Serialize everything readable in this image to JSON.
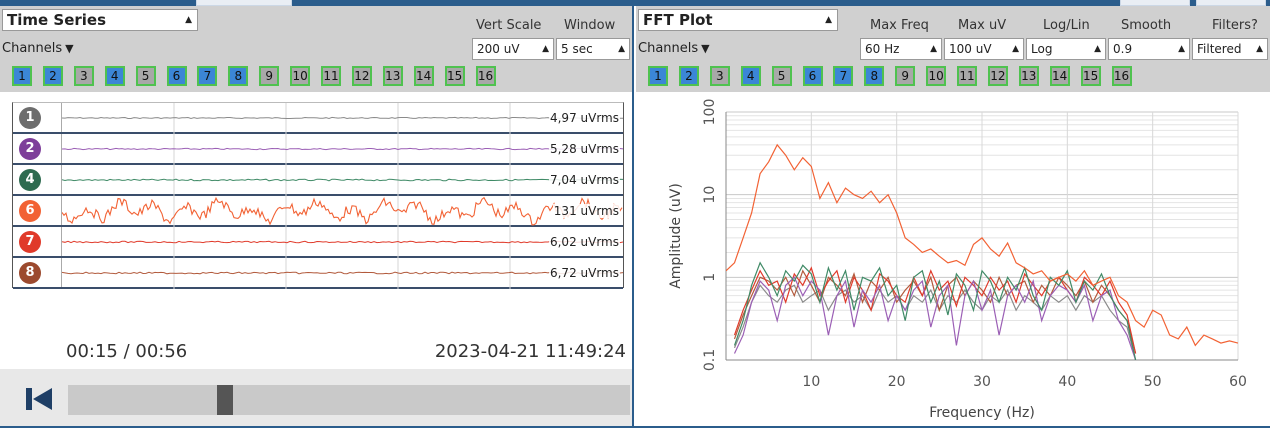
{
  "time_series": {
    "title": "Time Series",
    "vert_scale_label": "Vert Scale",
    "window_label": "Window",
    "vert_scale_value": "200 uV",
    "window_value": "5 sec",
    "channels_label": "Channels",
    "channel_buttons": [
      "1",
      "2",
      "3",
      "4",
      "5",
      "6",
      "7",
      "8",
      "9",
      "10",
      "11",
      "12",
      "13",
      "14",
      "15",
      "16"
    ],
    "channel_active": [
      true,
      true,
      false,
      true,
      false,
      true,
      true,
      true,
      false,
      false,
      false,
      false,
      false,
      false,
      false,
      false
    ],
    "rows": [
      {
        "channel": "1",
        "color": "#6d6d6d",
        "trace_color": "#8a8a8a",
        "rms": "4,97 uVrms",
        "amp": 0.7
      },
      {
        "channel": "2",
        "color": "#7e3f9a",
        "trace_color": "#9b5fb5",
        "rms": "5,28 uVrms",
        "amp": 0.8
      },
      {
        "channel": "4",
        "color": "#2e6b50",
        "trace_color": "#3f8a66",
        "rms": "7,04 uVrms",
        "amp": 1.0
      },
      {
        "channel": "6",
        "color": "#f26234",
        "trace_color": "#f26234",
        "rms": "131 uVrms",
        "amp": 12
      },
      {
        "channel": "7",
        "color": "#e03a2a",
        "trace_color": "#e03a2a",
        "rms": "6,02 uVrms",
        "amp": 0.9
      },
      {
        "channel": "8",
        "color": "#9c4a2e",
        "trace_color": "#b25a3c",
        "rms": "6,72 uVrms",
        "amp": 1.0
      }
    ],
    "time_display": "00:15 / 00:56",
    "timestamp": "2023-04-21 11:49:24",
    "playback_fraction": 0.28
  },
  "fft": {
    "title": "FFT Plot",
    "controls": [
      {
        "label": "Max Freq",
        "value": "60 Hz"
      },
      {
        "label": "Max uV",
        "value": "100 uV"
      },
      {
        "label": "Log/Lin",
        "value": "Log"
      },
      {
        "label": "Smooth",
        "value": "0.9"
      },
      {
        "label": "Filters?",
        "value": "Filtered"
      }
    ],
    "channels_label": "Channels",
    "channel_buttons": [
      "1",
      "2",
      "3",
      "4",
      "5",
      "6",
      "7",
      "8",
      "9",
      "10",
      "11",
      "12",
      "13",
      "14",
      "15",
      "16"
    ],
    "channel_active": [
      true,
      true,
      false,
      true,
      false,
      true,
      true,
      true,
      false,
      false,
      false,
      false,
      false,
      false,
      false,
      false
    ]
  },
  "chart_data": {
    "type": "line",
    "title": "",
    "xlabel": "Frequency (Hz)",
    "ylabel": "Amplitude (uV)",
    "xlim": [
      0,
      60
    ],
    "ylim": [
      0.1,
      100
    ],
    "yscale": "log",
    "grid": true,
    "x_ticks": [
      "10",
      "20",
      "30",
      "40",
      "50",
      "60"
    ],
    "y_ticks": [
      "0.1",
      "1",
      "10",
      "100"
    ],
    "series": [
      {
        "color": "#f26234",
        "x": [
          0,
          1,
          2,
          3,
          4,
          5,
          6,
          7,
          8,
          9,
          10,
          11,
          12,
          13,
          14,
          15,
          16,
          17,
          18,
          19,
          20,
          21,
          22,
          23,
          24,
          25,
          26,
          27,
          28,
          29,
          30,
          31,
          32,
          33,
          34,
          35,
          36,
          37,
          38,
          39,
          40,
          41,
          42,
          43,
          44,
          45,
          46,
          47,
          48,
          49,
          50,
          51,
          52,
          53,
          54,
          55,
          56,
          57,
          58,
          59,
          60
        ],
        "y": [
          1.2,
          1.5,
          3,
          6,
          18,
          25,
          40,
          30,
          20,
          28,
          22,
          9,
          14,
          8,
          12,
          10,
          9,
          11,
          8,
          10,
          6,
          3,
          2.5,
          2,
          2.2,
          1.8,
          1.5,
          1.6,
          1.4,
          2.5,
          3,
          2.2,
          1.8,
          2.6,
          1.5,
          1.3,
          1.1,
          1.2,
          0.9,
          1.0,
          1.1,
          0.9,
          1.2,
          0.8,
          0.9,
          1.0,
          0.6,
          0.5,
          0.3,
          0.25,
          0.4,
          0.35,
          0.2,
          0.18,
          0.25,
          0.15,
          0.2,
          0.18,
          0.16,
          0.17,
          0.16
        ]
      },
      {
        "color": "#3f8a66",
        "x": [
          1,
          2,
          3,
          4,
          5,
          6,
          7,
          8,
          9,
          10,
          11,
          12,
          13,
          14,
          15,
          16,
          17,
          18,
          19,
          20,
          21,
          22,
          23,
          24,
          25,
          26,
          27,
          28,
          29,
          30,
          31,
          32,
          33,
          34,
          35,
          36,
          37,
          38,
          39,
          40,
          41,
          42,
          43,
          44,
          45,
          46,
          47,
          48
        ],
        "y": [
          0.15,
          0.3,
          0.8,
          1.5,
          1.0,
          0.6,
          1.2,
          0.9,
          1.4,
          1.1,
          0.5,
          1.3,
          0.7,
          1.2,
          0.4,
          1.0,
          0.9,
          1.3,
          0.6,
          0.8,
          0.3,
          1.0,
          1.2,
          0.5,
          0.9,
          0.35,
          1.1,
          0.8,
          0.4,
          1.2,
          0.9,
          0.5,
          1.0,
          0.7,
          1.3,
          0.6,
          0.4,
          1.0,
          0.8,
          1.2,
          0.5,
          0.9,
          0.7,
          1.1,
          0.6,
          0.4,
          0.3,
          0.1
        ]
      },
      {
        "color": "#9b5fb5",
        "x": [
          1,
          2,
          3,
          4,
          5,
          6,
          7,
          8,
          9,
          10,
          11,
          12,
          13,
          14,
          15,
          16,
          17,
          18,
          19,
          20,
          21,
          22,
          23,
          24,
          25,
          26,
          27,
          28,
          29,
          30,
          31,
          32,
          33,
          34,
          35,
          36,
          37,
          38,
          39,
          40,
          41,
          42,
          43,
          44,
          45,
          46,
          47,
          48
        ],
        "y": [
          0.12,
          0.2,
          0.5,
          0.9,
          0.7,
          0.3,
          0.8,
          1.0,
          0.6,
          0.9,
          0.7,
          0.2,
          0.6,
          0.9,
          0.25,
          0.7,
          0.5,
          0.8,
          0.3,
          0.6,
          0.4,
          0.7,
          0.9,
          0.25,
          0.6,
          0.8,
          0.15,
          0.6,
          0.9,
          0.4,
          0.7,
          0.2,
          0.6,
          0.8,
          0.5,
          0.9,
          0.3,
          0.6,
          0.8,
          0.7,
          0.5,
          0.8,
          0.3,
          0.6,
          0.7,
          0.3,
          0.2,
          0.1
        ]
      },
      {
        "color": "#e03a2a",
        "x": [
          1,
          2,
          3,
          4,
          5,
          6,
          7,
          8,
          9,
          10,
          11,
          12,
          13,
          14,
          15,
          16,
          17,
          18,
          19,
          20,
          21,
          22,
          23,
          24,
          25,
          26,
          27,
          28,
          29,
          30,
          31,
          32,
          33,
          34,
          35,
          36,
          37,
          38,
          39,
          40,
          41,
          42,
          43,
          44,
          45,
          46,
          47,
          48
        ],
        "y": [
          0.2,
          0.4,
          0.7,
          1.2,
          0.8,
          0.9,
          0.5,
          1.1,
          0.8,
          1.3,
          0.6,
          0.9,
          1.2,
          0.5,
          1.0,
          0.7,
          0.4,
          1.1,
          0.9,
          0.6,
          0.5,
          1.0,
          0.6,
          1.2,
          0.7,
          0.9,
          0.45,
          1.0,
          0.8,
          0.6,
          1.0,
          0.7,
          0.9,
          0.5,
          1.1,
          0.8,
          0.6,
          0.9,
          1.0,
          0.7,
          0.5,
          1.0,
          0.8,
          0.6,
          0.9,
          0.5,
          0.35,
          0.12
        ]
      },
      {
        "color": "#b25a3c",
        "x": [
          1,
          2,
          3,
          4,
          5,
          6,
          7,
          8,
          9,
          10,
          11,
          12,
          13,
          14,
          15,
          16,
          17,
          18,
          19,
          20,
          21,
          22,
          23,
          24,
          25,
          26,
          27,
          28,
          29,
          30,
          31,
          32,
          33,
          34,
          35,
          36,
          37,
          38,
          39,
          40,
          41,
          42,
          43,
          44,
          45,
          46,
          47,
          48
        ],
        "y": [
          0.18,
          0.35,
          0.6,
          1.0,
          0.9,
          0.7,
          1.0,
          0.6,
          1.2,
          0.8,
          0.5,
          1.0,
          0.8,
          0.6,
          1.1,
          0.5,
          0.9,
          0.7,
          1.0,
          0.5,
          0.7,
          0.9,
          0.6,
          1.0,
          0.4,
          0.8,
          1.0,
          0.6,
          0.9,
          0.7,
          0.5,
          1.0,
          0.6,
          0.8,
          0.9,
          0.5,
          0.8,
          0.6,
          1.0,
          0.8,
          0.6,
          0.9,
          0.5,
          0.8,
          0.6,
          0.4,
          0.3,
          0.12
        ]
      },
      {
        "color": "#8a8a8a",
        "x": [
          1,
          2,
          3,
          4,
          5,
          6,
          7,
          8,
          9,
          10,
          11,
          12,
          13,
          14,
          15,
          16,
          17,
          18,
          19,
          20,
          21,
          22,
          23,
          24,
          25,
          26,
          27,
          28,
          29,
          30,
          31,
          32,
          33,
          34,
          35,
          36,
          37,
          38,
          39,
          40,
          41,
          42,
          43,
          44,
          45,
          46,
          47,
          48
        ],
        "y": [
          0.14,
          0.25,
          0.5,
          0.8,
          0.6,
          0.5,
          0.7,
          0.8,
          0.5,
          0.6,
          0.7,
          0.4,
          0.6,
          0.7,
          0.5,
          0.6,
          0.4,
          0.7,
          0.5,
          0.6,
          0.4,
          0.6,
          0.5,
          0.7,
          0.4,
          0.6,
          0.5,
          0.7,
          0.5,
          0.4,
          0.6,
          0.5,
          0.7,
          0.4,
          0.6,
          0.5,
          0.4,
          0.6,
          0.5,
          0.6,
          0.4,
          0.6,
          0.5,
          0.6,
          0.4,
          0.3,
          0.25,
          0.1
        ]
      }
    ]
  }
}
